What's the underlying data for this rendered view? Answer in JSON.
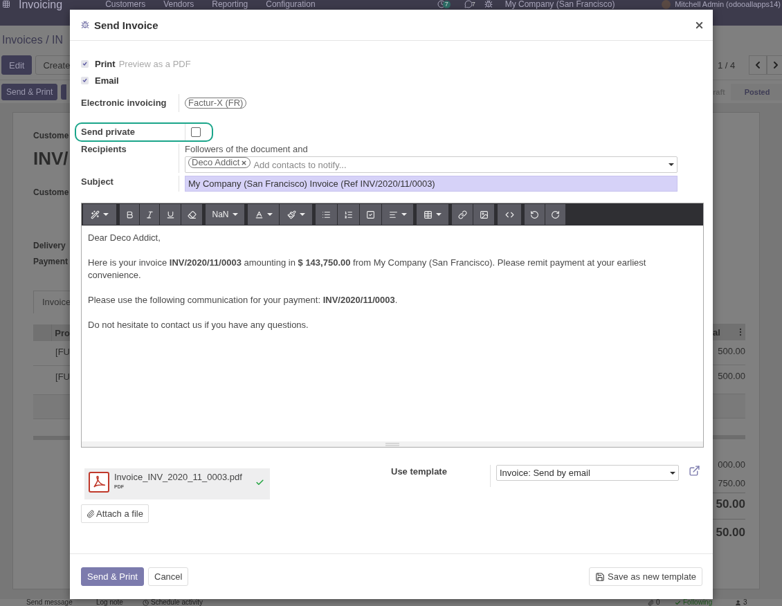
{
  "navbar": {
    "app_name": "Invoicing",
    "menu": [
      "Customers",
      "Vendors",
      "Reporting",
      "Configuration"
    ],
    "activity_count": "7",
    "message_count": "7",
    "company": "My Company (San Francisco)",
    "user": "Mitchell Admin (odooallapps14)"
  },
  "breadcrumb": "Invoices / IN",
  "control_buttons": [
    {
      "label": "Edit",
      "kind": "primary"
    },
    {
      "label": "Create",
      "kind": "secondary"
    }
  ],
  "pager": "1 / 4",
  "action_buttons": [
    {
      "label": "Send & Print"
    }
  ],
  "status_steps": [
    {
      "label": "raft",
      "selected": false
    },
    {
      "label": "Posted",
      "selected": true
    }
  ],
  "sheet": {
    "customer_label": "Custome",
    "title": "INV/",
    "field_labels": [
      "Custome",
      "Delivery",
      "Payment"
    ],
    "tab": "Invoice",
    "columns": [
      "Pro",
      "al"
    ],
    "lines": [
      {
        "product": "[FU",
        "subtotal": "500.00"
      },
      {
        "product": "[FU",
        "subtotal": "500.00"
      }
    ],
    "totals": [
      {
        "amount": "000.00",
        "kind": "line"
      },
      {
        "amount": "750.00",
        "kind": "line"
      },
      {
        "amount": "50.00",
        "kind": "total"
      },
      {
        "amount": "50.00",
        "kind": "total"
      }
    ]
  },
  "chatter": {
    "actions": [
      "Send message",
      "Log note",
      "Schedule activity"
    ],
    "attachment_count": "0",
    "follow": "Following",
    "follower_count": "3"
  },
  "dialog": {
    "title": "Send Invoice",
    "options": [
      {
        "label": "Print",
        "hint": "Preview as a PDF",
        "checked": true
      },
      {
        "label": "Email",
        "checked": true
      }
    ],
    "edi_label": "Electronic invoicing",
    "edi_formats": [
      "Factur-X (FR)"
    ],
    "private_label": "Send private",
    "send_private": false,
    "recipients_label": "Recipients",
    "recipients_intro": "Followers of the document and",
    "recipients": [
      "Deco Addict"
    ],
    "recipients_placeholder": "Add contacts to notify...",
    "subject_label": "Subject",
    "subject": "My Company (San Francisco) Invoice (Ref INV/2020/11/0003)",
    "font_size": "NaN",
    "body": [
      "Dear Deco Addict,",
      "Here is your invoice **INV/2020/11/0003** amounting in **$ 143,750.00** from My Company (San Francisco). Please remit payment at your earliest convenience.",
      "Please use the following communication for your payment: **INV/2020/11/0003**.",
      "Do not hesitate to contact us if you have any questions."
    ],
    "attachments": [
      {
        "name": "Invoice_INV_2020_11_0003.pdf",
        "type": "PDF",
        "uploaded": true
      }
    ],
    "attach_button": "Attach a file",
    "template_label": "Use template",
    "template": "Invoice: Send by email",
    "buttons": [
      {
        "label": "Send & Print",
        "kind": "primary"
      },
      {
        "label": "Cancel",
        "kind": "secondary"
      }
    ],
    "save_template": "Save as new template"
  }
}
